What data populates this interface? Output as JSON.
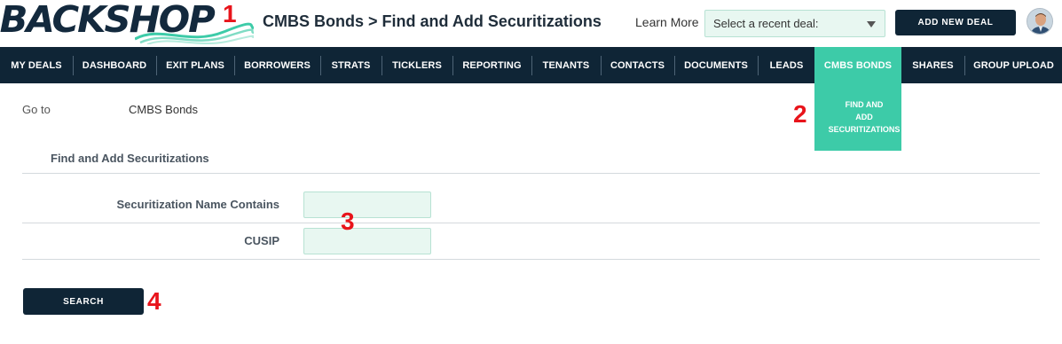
{
  "header": {
    "logo_text": "BACKSHOP",
    "page_title": "CMBS Bonds > Find and Add Securitizations",
    "learn_more": "Learn More",
    "recent_deal_placeholder": "Select a recent deal:",
    "add_new_deal": "ADD NEW DEAL"
  },
  "nav": {
    "items": [
      {
        "label": "MY DEALS"
      },
      {
        "label": "DASHBOARD"
      },
      {
        "label": "EXIT PLANS"
      },
      {
        "label": "BORROWERS"
      },
      {
        "label": "STRATS"
      },
      {
        "label": "TICKLERS"
      },
      {
        "label": "REPORTING"
      },
      {
        "label": "TENANTS"
      },
      {
        "label": "CONTACTS"
      },
      {
        "label": "DOCUMENTS"
      },
      {
        "label": "LEADS"
      },
      {
        "label": "CMBS BONDS",
        "active": true
      },
      {
        "label": "SHARES"
      },
      {
        "label": "GROUP UPLOAD"
      }
    ],
    "dropdown_item": "FIND AND\nADD\nSECURITIZATIONS"
  },
  "goto": {
    "label": "Go to",
    "link": "CMBS Bonds"
  },
  "form": {
    "section_title": "Find and Add Securitizations",
    "fields": [
      {
        "label": "Securitization Name Contains",
        "value": ""
      },
      {
        "label": "CUSIP",
        "value": ""
      }
    ],
    "search_button": "SEARCH"
  },
  "callouts": [
    "1",
    "2",
    "3",
    "4"
  ],
  "colors": {
    "navy": "#0f2536",
    "teal": "#3dcba8",
    "input_bg": "#e8f7f1",
    "callout_red": "#e8141b"
  },
  "icons": {
    "logo_wave": "wave-icon",
    "select_arrow": "triangle-down-icon",
    "avatar": "user-avatar-icon"
  }
}
